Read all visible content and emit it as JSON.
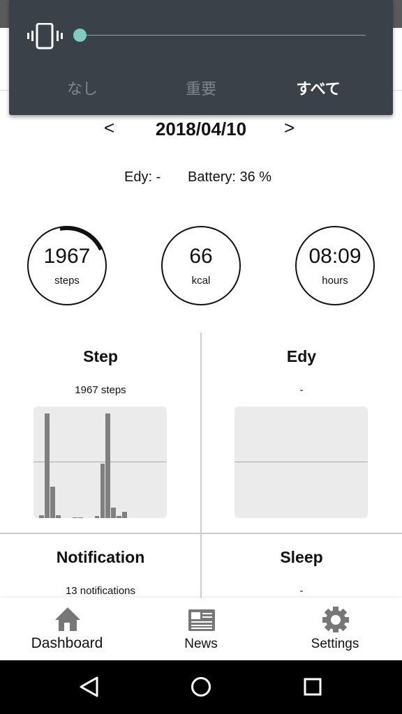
{
  "volume_panel": {
    "icon": "vibrate-icon",
    "level": 0,
    "accent": "#7fcdc0",
    "options": [
      {
        "label": "なし",
        "selected": false
      },
      {
        "label": "重要",
        "selected": false
      },
      {
        "label": "すべて",
        "selected": true
      }
    ]
  },
  "date": {
    "prev": "<",
    "value": "2018/04/10",
    "next": ">"
  },
  "info": {
    "edy": "Edy: -",
    "battery": "Battery: 36 %"
  },
  "rings": [
    {
      "value": "1967",
      "unit": "steps",
      "progress": 0.21
    },
    {
      "value": "66",
      "unit": "kcal"
    },
    {
      "value": "08:09",
      "unit": "hours"
    }
  ],
  "cards": [
    {
      "title": "Step",
      "subtitle": "1967 steps"
    },
    {
      "title": "Edy",
      "subtitle": "-"
    },
    {
      "title": "Notification",
      "subtitle": "13 notifications"
    },
    {
      "title": "Sleep",
      "subtitle": "-"
    }
  ],
  "chart_data": {
    "type": "bar",
    "title": "",
    "values": [
      0,
      4,
      154,
      46,
      4,
      0,
      0,
      1,
      1,
      0,
      0,
      3,
      80,
      154,
      15,
      3,
      9,
      0,
      0,
      0,
      0,
      0,
      0,
      0
    ],
    "ylim": [
      0,
      160
    ]
  },
  "nav": [
    {
      "label": "Dashboard",
      "icon": "home-icon"
    },
    {
      "label": "News",
      "icon": "news-icon"
    },
    {
      "label": "Settings",
      "icon": "gear-icon"
    }
  ],
  "system": [
    "back-icon",
    "home-circle-icon",
    "recents-icon"
  ]
}
